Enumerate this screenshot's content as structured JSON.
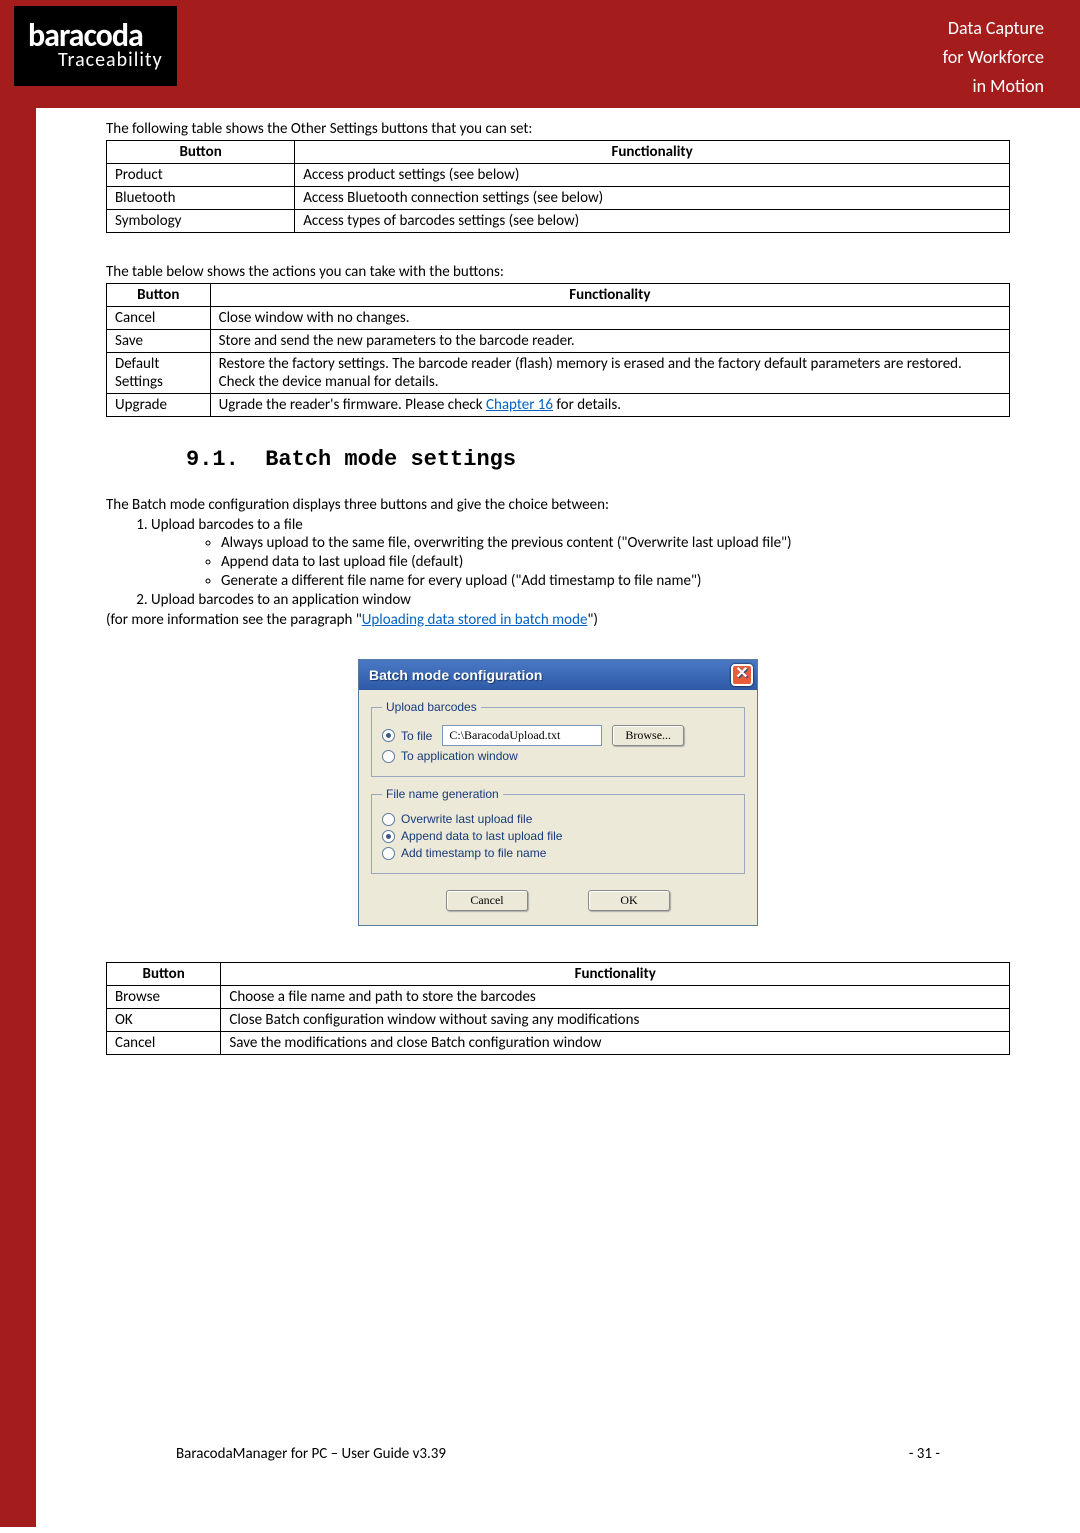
{
  "header": {
    "logo_top": "baracoda",
    "logo_bottom": "Traceability",
    "tag1": "Data Capture",
    "tag2": "for Workforce",
    "tag3": "in Motion"
  },
  "intro1": "The following table shows the Other Settings buttons that you can set:",
  "table1": {
    "h1": "Button",
    "h2": "Functionality",
    "rows": [
      {
        "b": "Product",
        "f": "Access product settings (see below)"
      },
      {
        "b": "Bluetooth",
        "f": "Access Bluetooth connection settings (see below)"
      },
      {
        "b": "Symbology",
        "f": "Access types of barcodes settings (see below)"
      }
    ]
  },
  "intro2": "The table below shows the actions you can take with the buttons:",
  "table2": {
    "h1": "Button",
    "h2": "Functionality",
    "rows": [
      {
        "b": "Cancel",
        "f": "Close window with no changes."
      },
      {
        "b": "Save",
        "f": "Store and send the new parameters to the barcode reader."
      },
      {
        "b": "Default Settings",
        "f": "Restore the factory settings. The barcode reader (flash) memory is erased and the factory default parameters are restored. Check the device manual for details."
      },
      {
        "b": "Upgrade",
        "f_pre": "Ugrade the reader's firmware. Please check ",
        "f_link": "Chapter 16",
        "f_post": " for details."
      }
    ]
  },
  "section": {
    "num": "9.1.",
    "title": "Batch mode settings"
  },
  "body": {
    "p1": "The Batch mode configuration displays three buttons and give the choice between:",
    "li1": "Upload barcodes to a file",
    "li1a": "Always upload to the same file, overwriting the previous content (\"Overwrite last upload file\")",
    "li1b": "Append data to last upload file (default)",
    "li1c": "Generate a different file name for every upload (\"Add timestamp to file name\")",
    "li2": "Upload barcodes to an application window",
    "p2_pre": "(for more information see the paragraph \"",
    "p2_link": "Uploading data stored in batch mode",
    "p2_post": "\")"
  },
  "dialog": {
    "title": "Batch mode configuration",
    "grp1": "Upload barcodes",
    "r_tofile": "To file",
    "path": "C:\\BaracodaUpload.txt",
    "browse": "Browse...",
    "r_toapp": "To application window",
    "grp2": "File name generation",
    "r_over": "Overwrite last upload file",
    "r_append": "Append data to last upload file",
    "r_ts": "Add timestamp to file name",
    "cancel": "Cancel",
    "ok": "OK"
  },
  "table3": {
    "h1": "Button",
    "h2": "Functionality",
    "rows": [
      {
        "b": "Browse",
        "f": "Choose a file name and path to store the barcodes"
      },
      {
        "b": "OK",
        "f": "Close Batch configuration window without saving any modifications"
      },
      {
        "b": "Cancel",
        "f": "Save the modifications and close Batch configuration window"
      }
    ]
  },
  "footer": {
    "left": "BaracodaManager for PC – User Guide v3.39",
    "right": "- 31 -"
  }
}
